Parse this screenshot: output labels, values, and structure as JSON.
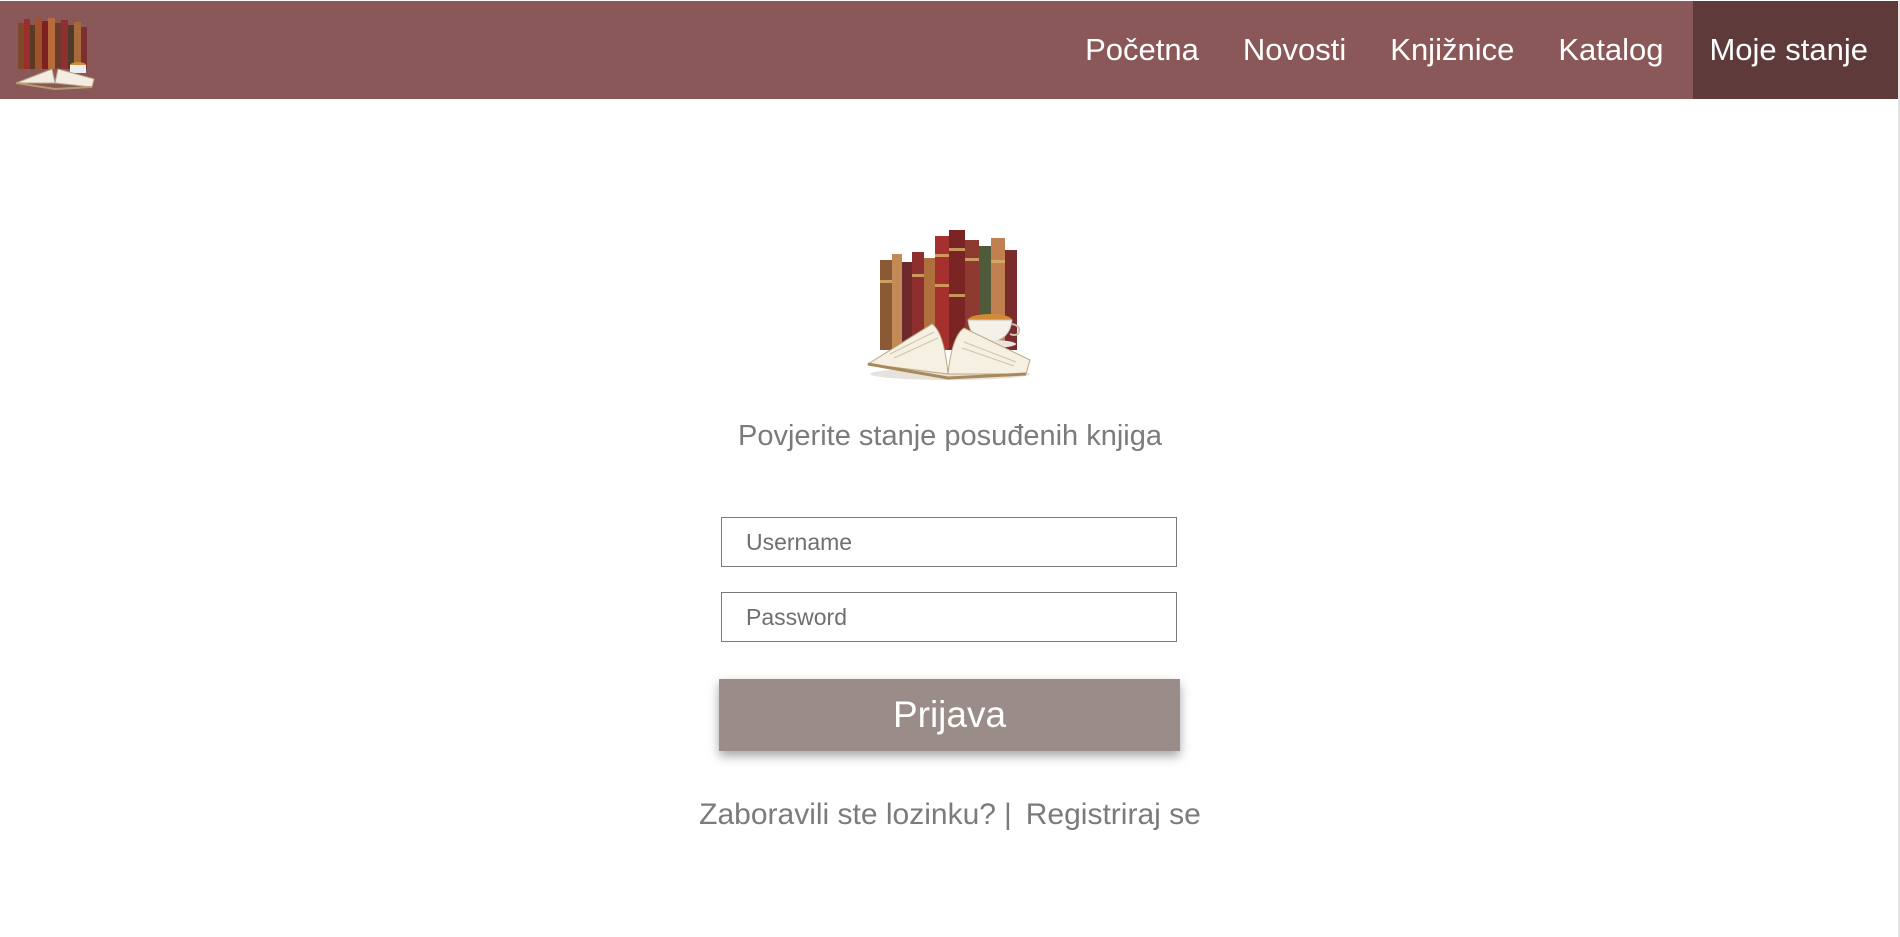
{
  "header": {
    "logo_icon": "library-books-logo-icon",
    "nav": [
      {
        "label": "Početna"
      },
      {
        "label": "Novosti"
      },
      {
        "label": "Knjižnice"
      },
      {
        "label": "Katalog"
      },
      {
        "label": "Moje stanje",
        "active": true
      }
    ],
    "bar_color": "#8a5859",
    "active_color": "#5e3a3b"
  },
  "login": {
    "image_icon": "books-and-coffee-illustration",
    "subtitle": "Povjerite stanje posuđenih knjiga",
    "username": {
      "value": "",
      "placeholder": "Username"
    },
    "password": {
      "value": "",
      "placeholder": "Password"
    },
    "submit_label": "Prijava",
    "button_color": "#998c89",
    "forgot_label": "Zaboravili ste lozinku?",
    "separator": "|",
    "register_label": "Registriraj se"
  }
}
